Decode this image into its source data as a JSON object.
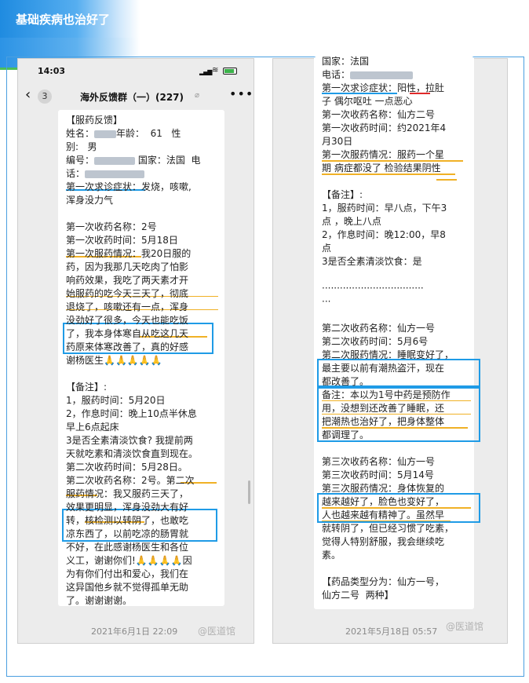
{
  "banner": {
    "title": "基础疾病也治好了"
  },
  "phone": {
    "time": "14:03",
    "signal": "▂▄▆",
    "wifi": "≋",
    "back_arrow": "‹",
    "back_count": "3",
    "chat_title": "海外反馈群（一）(227)",
    "mute_icon": "bell-slash-icon",
    "more_icon": "•••"
  },
  "left_message": {
    "lines": [
      "【服药反馈】",
      "姓名：",
      "年龄：  61   性",
      "别:   男",
      "编号：",
      " 国家：法国  电",
      "话：",
      "第一次求诊症状：发烧，咳嗽,",
      "浑身没力气",
      "",
      "第一次收药名称：2号",
      "第一次收药时间：5月18日",
      "第一次服药情况：我20日服的",
      "药，因为我那几天吃肉了怕影",
      "响药效果，我吃了两天素才开",
      "始服药的吃今天三天了，彻底",
      "退烧了，咳嗽还有一点，浑身",
      "没劲好了很多，今天也能吃饭",
      "了，我本身体寒自从吃这几天",
      "药原来体寒改善了，真的好感",
      "谢杨医生🙏🙏🙏🙏🙏",
      "",
      "【备注】:",
      "1，服药时间：5月20日",
      "2，作息时间：晚上10点半休息",
      "早上6点起床",
      "3是否全素清淡饮食? 我提前两",
      "天就吃素和清淡饮食直到现在。",
      "第二次收药时间：5月28日。",
      "第二次收药名称：2号。第二次",
      "服药情况：我又服药三天了，",
      "效果更明显，浑身没劲大有好",
      "转，核检测以转阴了，也敢吃",
      "凉东西了，以前吃凉的肠胃就",
      "不好，在此感谢杨医生和各位",
      "义工，谢谢你们!🙏🙏🙏🙏因",
      "为有你们付出和爱心，我们在",
      "这异国他乡就不觉得孤单无助",
      "了。谢谢谢谢。"
    ],
    "footer_date": "2021年6月1日 22:09",
    "watermark": "@医道馆"
  },
  "right_message": {
    "lines": [
      "国家：法国",
      "电话：",
      "第一次求诊症状：阳性，拉肚",
      "子 偶尔呕吐 一点恶心",
      "第一次收药名称：仙方二号",
      "第一次收药时间：约2021年4",
      "月30日",
      "第一次服药情况：服药一个星",
      "期 病症都没了 检验结果阴性",
      "",
      "【备注】:",
      "1，服药时间：早八点，下午3",
      "点 ，晚上八点",
      "2，作息时间：晚12:00，早8",
      "点",
      "3是否全素清淡饮食：是",
      "",
      "··································",
      "···",
      "",
      "第二次收药名称：仙方一号",
      "第二次收药时间：5月6号",
      "第二次服药情况：睡眠变好了，",
      "最主要以前有潮热盗汗，现在",
      "都改善了。",
      "备注：本以为1号中药是预防作",
      "用，没想到还改善了睡眠，还",
      "把潮热也治好了，把身体整体",
      "都调理了。",
      "",
      "第三次收药名称：仙方一号",
      "第三次收药时间：5月14号",
      "第三次服药情况：身体恢复的",
      "越来越好了，脸色也变好了，",
      "人也越来越有精神了。虽然早",
      "就转阴了，但已经习惯了吃素，",
      "觉得人特别舒服，我会继续吃",
      "素。",
      "",
      "【药品类型分为：仙方一号，",
      "仙方二号  两种】"
    ],
    "footer_date": "2021年5月18日 05:57",
    "watermark": "@医道馆"
  },
  "colors": {
    "highlight_box": "#1f9be6",
    "underline_orange": "#f0b126",
    "underline_red": "#e02a2a",
    "banner_blue": "#1f8be0",
    "accent_green": "#4bbf5a"
  }
}
